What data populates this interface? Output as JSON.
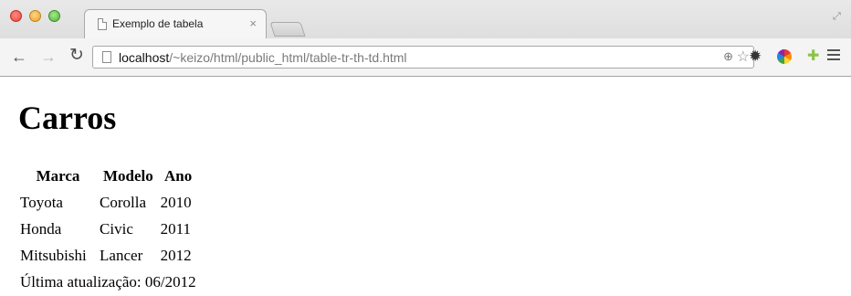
{
  "browser": {
    "tab_title": "Exemplo de tabela",
    "tab_close": "×",
    "url_host": "localhost",
    "url_path": "/~keizo/html/public_html/table-tr-th-td.html",
    "icons": {
      "back": "arrow-left",
      "forward": "arrow-right",
      "reload": "reload",
      "zoom": "zoom",
      "bookmark": "star",
      "extension1": "gear",
      "extension2": "pinwheel",
      "extension3": "android",
      "menu": "hamburger"
    }
  },
  "page": {
    "heading": "Carros",
    "table": {
      "headers": [
        "Marca",
        "Modelo",
        "Ano"
      ],
      "rows": [
        [
          "Toyota",
          "Corolla",
          "2010"
        ],
        [
          "Honda",
          "Civic",
          "2011"
        ],
        [
          "Mitsubishi",
          "Lancer",
          "2012"
        ]
      ],
      "footer": "Última atualização: 06/2012"
    }
  }
}
